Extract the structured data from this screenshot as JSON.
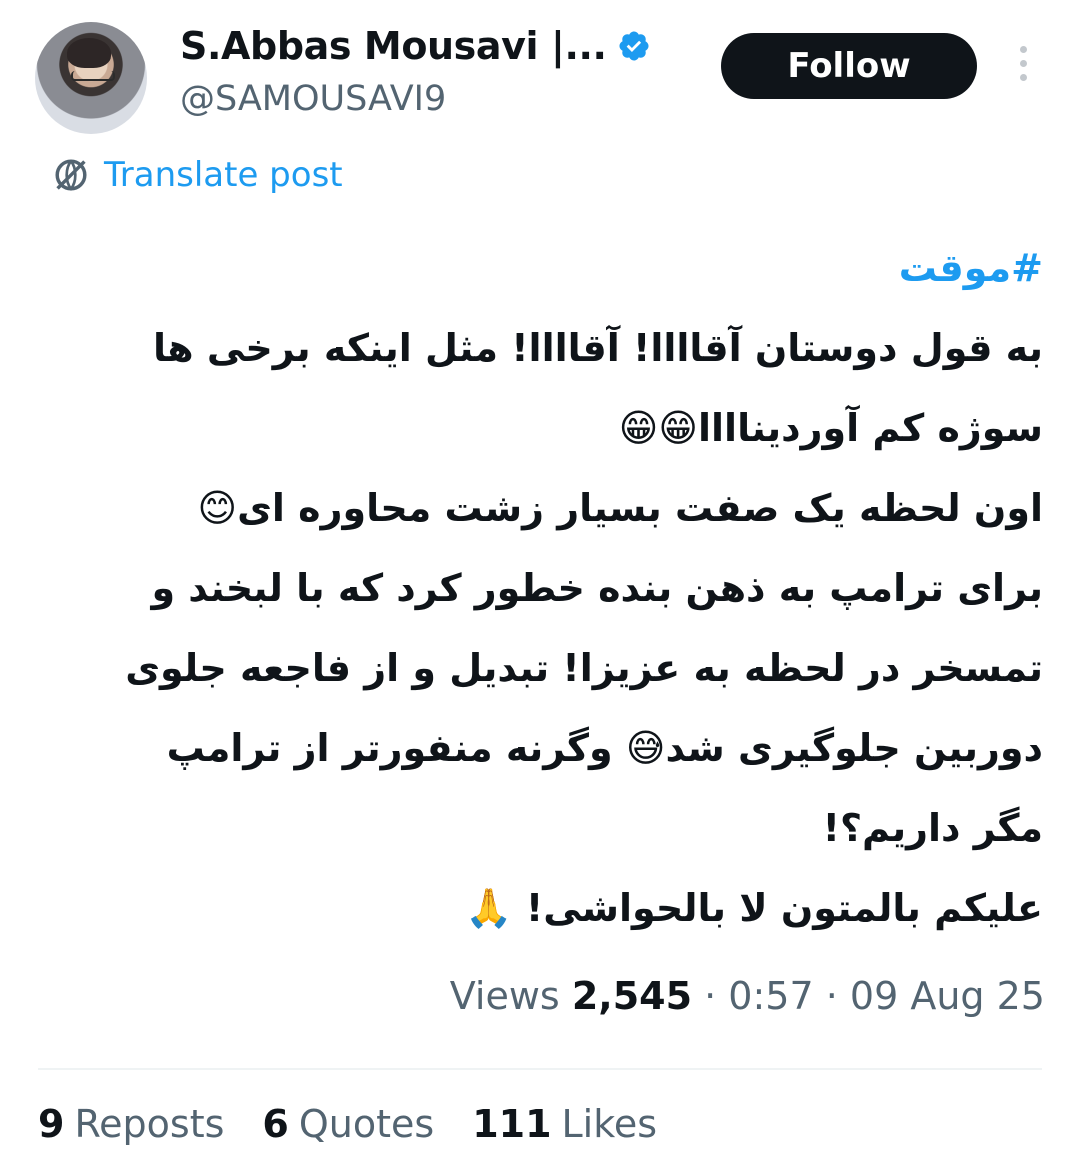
{
  "user": {
    "display_name": "S.Abbas Mousavi |...",
    "handle": "@SAMOUSAVI9",
    "verified": true
  },
  "actions": {
    "follow_label": "Follow",
    "translate_label": "Translate post"
  },
  "post": {
    "hashtag": "#موقت",
    "lines": [
      "به قول دوستان آقاااا! آقاااا! مثل اینکه برخی ها",
      "سوژه کم آوردیناااا😁😁",
      "اون لحظه یک صفت بسیار زشت محاوره ای😊",
      "برای ترامپ به ذهن بنده خطور کرد که با لبخند و",
      "تمسخر در لحظه به عزیزا! تبدیل و از فاجعه جلوی",
      "دوربین جلوگیری شد😅 وگرنه منفورتر از ترامپ",
      "مگر داریم؟!",
      "علیکم بالمتون لا بالحواشی! 🙏"
    ]
  },
  "meta": {
    "views_label": "Views",
    "views_value": "2,545",
    "time": "0:57",
    "date": "09 Aug 25",
    "separator": "·"
  },
  "stats": {
    "reposts_count": "9",
    "reposts_label": "Reposts",
    "quotes_count": "6",
    "quotes_label": "Quotes",
    "likes_count": "111",
    "likes_label": "Likes"
  },
  "colors": {
    "accent": "#1d9bf0",
    "text": "#0f1419",
    "secondary": "#536471"
  }
}
